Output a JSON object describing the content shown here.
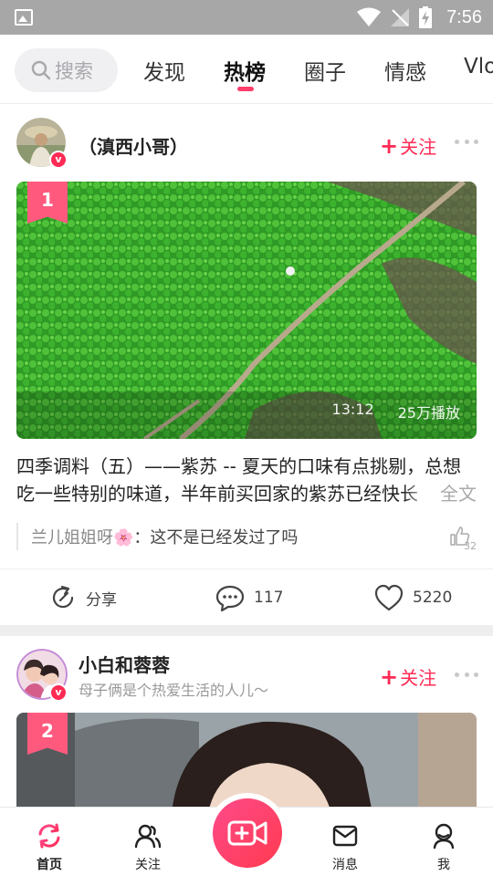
{
  "status_bar": {
    "time": "7:56"
  },
  "top_tabs": {
    "search_label": "搜索",
    "tabs": [
      "发现",
      "热榜",
      "圈子",
      "情感",
      "Vlo"
    ]
  },
  "posts": [
    {
      "author": "（滇西小哥）",
      "follow_label": "关注",
      "rank": "1",
      "duration": "13:12",
      "plays": "25万播放",
      "text": "四季调料（五）——紫苏 -- 夏天的口味有点挑剔，总想吃一些特别的味道，半年前买回家的紫苏已经快长",
      "expand_label": "全文",
      "comment": {
        "user": "兰儿姐姐呀🌸",
        "text": "：这不是已经发过了吗",
        "likes": "32"
      },
      "share_label": "分享",
      "comments_count": "117",
      "likes_count": "5220"
    },
    {
      "author": "小白和蓉蓉",
      "bio": "母子俩是个热爱生活的人儿～",
      "follow_label": "关注",
      "rank": "2"
    }
  ],
  "bottom_nav": {
    "items": [
      "首页",
      "关注",
      "消息",
      "我"
    ]
  },
  "colors": {
    "accent": "#ff2b55",
    "badge": "#ff5a7e"
  }
}
